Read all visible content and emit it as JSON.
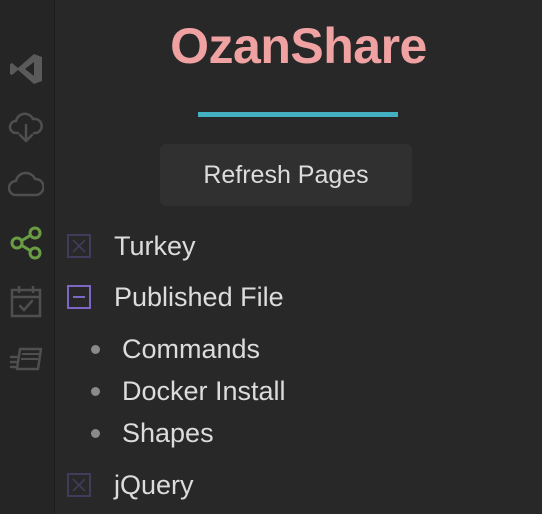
{
  "activity_bar": {
    "items": [
      {
        "icon": "vscode-logo-icon"
      },
      {
        "icon": "cloud-download-icon"
      },
      {
        "icon": "cloud-icon"
      },
      {
        "icon": "share-icon",
        "active": true,
        "color": "#6a9d43"
      },
      {
        "icon": "calendar-check-icon"
      },
      {
        "icon": "cards-stack-icon"
      }
    ]
  },
  "header": {
    "title": "OzanShare",
    "title_color": "#f0a2a2",
    "accent_color": "#43b1c1"
  },
  "actions": {
    "refresh_label": "Refresh Pages"
  },
  "tree": {
    "items": [
      {
        "label": "Turkey",
        "state": "collapsed"
      },
      {
        "label": "Published File",
        "state": "expanded",
        "children": [
          "Commands",
          "Docker Install",
          "Shapes"
        ]
      },
      {
        "label": "jQuery",
        "state": "collapsed"
      }
    ]
  }
}
